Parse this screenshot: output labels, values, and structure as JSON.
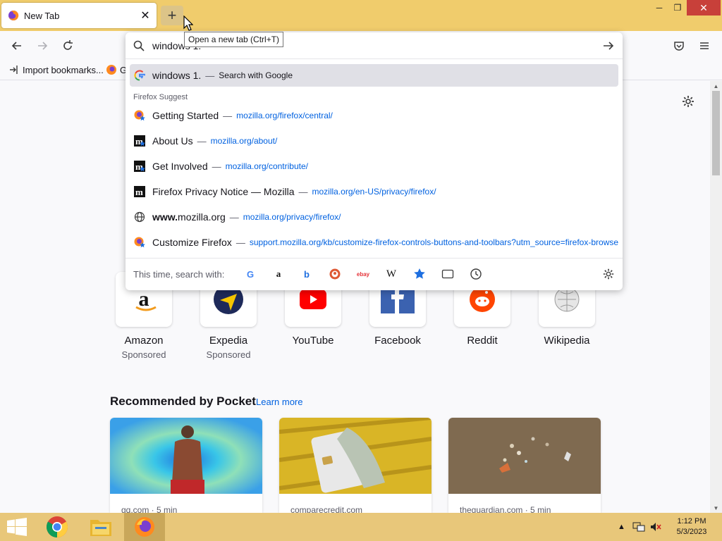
{
  "window": {
    "tab_title": "New Tab",
    "tab_close": "✕",
    "new_tab_button": "+",
    "tooltip": "Open a new tab (Ctrl+T)",
    "minimize": "─",
    "restore": "❐",
    "close": "✕"
  },
  "urlbar": {
    "value": "windows 1.",
    "selected_suggestion": {
      "text": "windows 1.",
      "action": "Search with Google"
    },
    "group_label": "Firefox Suggest",
    "suggestions": [
      {
        "icon": "firefox-icon",
        "title": "Getting Started",
        "url": "mozilla.org/firefox/central/"
      },
      {
        "icon": "mozilla-m-icon",
        "title": "About Us",
        "url": "mozilla.org/about/"
      },
      {
        "icon": "mozilla-m-icon",
        "title": "Get Involved",
        "url": "mozilla.org/contribute/"
      },
      {
        "icon": "mozilla-m-icon",
        "title": "Firefox Privacy Notice — Mozilla",
        "url": "mozilla.org/en-US/privacy/firefox/"
      },
      {
        "icon": "globe-icon",
        "title_bold": "www.",
        "title": "mozilla.org",
        "url": "mozilla.org/privacy/firefox/"
      },
      {
        "icon": "firefox-icon",
        "title": "Customize Firefox",
        "url": "support.mozilla.org/kb/customize-firefox-controls-buttons-and-toolbars?utm_source=firefox-browser"
      }
    ],
    "dash": "—",
    "oneoff_label": "This time, search with:",
    "engines": [
      "google-icon",
      "amazon-icon",
      "bing-icon",
      "duckduckgo-icon",
      "ebay-icon",
      "wikipedia-icon",
      "bookmarks-star-icon",
      "tabs-icon",
      "history-icon",
      "search-settings-gear-icon"
    ],
    "engine_glyphs": {
      "google": "G",
      "amazon": "a",
      "bing": "b",
      "ebay": "ebay",
      "wikipedia": "W"
    }
  },
  "bookmarks_bar": {
    "import": "Import bookmarks...",
    "second": "G"
  },
  "top_sites": [
    {
      "label": "Amazon",
      "sub": "Sponsored"
    },
    {
      "label": "Expedia",
      "sub": "Sponsored"
    },
    {
      "label": "YouTube",
      "sub": ""
    },
    {
      "label": "Facebook",
      "sub": ""
    },
    {
      "label": "Reddit",
      "sub": ""
    },
    {
      "label": "Wikipedia",
      "sub": ""
    }
  ],
  "pocket": {
    "title": "Recommended by Pocket",
    "learn_more": "Learn more",
    "cards": [
      {
        "source": "gq.com · 5 min"
      },
      {
        "source": "comparecredit.com"
      },
      {
        "source": "theguardian.com · 5 min"
      }
    ]
  },
  "taskbar": {
    "clock_time": "1:12 PM",
    "clock_date": "5/3/2023",
    "tray_arrow": "▲"
  },
  "colors": {
    "titlebar": "#f0cc6c",
    "taskbar": "#e8c77a",
    "link": "#0061e0",
    "selected_row": "#e0e0e6"
  }
}
